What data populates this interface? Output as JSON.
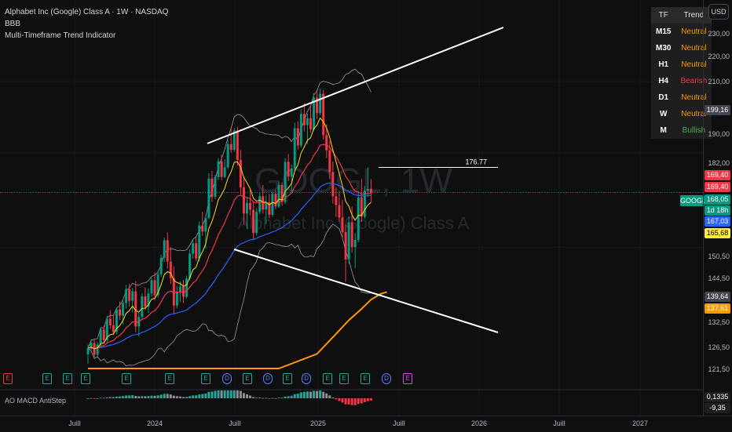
{
  "header": {
    "title": "Alphabet Inc (Google) Class A · 1W · NASDAQ",
    "indicator1": "BBB",
    "indicator2": "Multi-Timeframe Trend Indicator"
  },
  "watermark": {
    "ticker": "GOOGL, 1W",
    "name": "Alphabet Inc (Google) Class A"
  },
  "currency_button": "USD",
  "trend_table": {
    "headers": [
      "TF",
      "Trend"
    ],
    "rows": [
      {
        "tf": "M15",
        "trend": "Neutral",
        "color": "#ff9800"
      },
      {
        "tf": "M30",
        "trend": "Neutral",
        "color": "#ff9800"
      },
      {
        "tf": "H1",
        "trend": "Neutral",
        "color": "#ff9800"
      },
      {
        "tf": "H4",
        "trend": "Bearish",
        "color": "#f23645"
      },
      {
        "tf": "D1",
        "trend": "Neutral",
        "color": "#ff9800"
      },
      {
        "tf": "W",
        "trend": "Neutral",
        "color": "#ff9800"
      },
      {
        "tf": "M",
        "trend": "Bullish",
        "color": "#4caf50"
      }
    ]
  },
  "price_axis": {
    "labels": [
      "230,00",
      "220,00",
      "210,00",
      "190,00",
      "182,00",
      "150,50",
      "144,50",
      "132,50",
      "126,50",
      "121,50"
    ],
    "tags": [
      {
        "text": "199,16",
        "bg": "#434651"
      },
      {
        "text": "169,40",
        "bg": "#f23645"
      },
      {
        "text": "169,40",
        "bg": "#f23645"
      },
      {
        "text": "168,05",
        "bg": "#089981"
      },
      {
        "text": "1d 18h",
        "bg": "#089981"
      },
      {
        "text": "167,03",
        "bg": "#2962ff"
      },
      {
        "text": "165,68",
        "bg": "#ffeb3b",
        "fg": "#000000"
      },
      {
        "text": "139,64",
        "bg": "#434651"
      },
      {
        "text": "137,61",
        "bg": "#ff9800"
      },
      {
        "text": "0,1335",
        "bg": "#1e1e1e"
      },
      {
        "text": "-9,35",
        "bg": "#1e1e1e"
      }
    ]
  },
  "ticker_tag": "GOOGL",
  "level_label": "176.77",
  "time_axis": [
    "Juill",
    "2024",
    "Juill",
    "2025",
    "Juill",
    "2026",
    "Juill",
    "2027"
  ],
  "oscillator_label": "AO MACD AntiStep",
  "markers": {
    "e": "E",
    "d": "D"
  },
  "colors": {
    "up": "#089981",
    "down": "#f23645",
    "ema_fast": "#f9d71c",
    "ema_mid": "#f23645",
    "ema_slow": "#2962ff",
    "sma_long": "#ff9800",
    "bands": "#9598a1",
    "trendline": "#ffffff"
  },
  "chart_data": {
    "type": "candlestick",
    "title": "Alphabet Inc (Google) Class A · 1W · NASDAQ",
    "y_scale": "log",
    "ylim": [
      118,
      236
    ],
    "level": 176.77,
    "last_close": 168.05,
    "candles": [
      [
        121.4,
        123.8,
        119.2,
        122.9
      ],
      [
        122.9,
        125.1,
        121.8,
        124.2
      ],
      [
        124.2,
        125.0,
        120.6,
        121.3
      ],
      [
        121.3,
        124.4,
        120.9,
        123.8
      ],
      [
        123.8,
        128.2,
        123.1,
        127.6
      ],
      [
        127.6,
        128.6,
        124.0,
        124.9
      ],
      [
        124.9,
        131.2,
        124.3,
        130.4
      ],
      [
        130.4,
        132.7,
        127.8,
        128.7
      ],
      [
        128.7,
        131.6,
        126.2,
        127.0
      ],
      [
        127.0,
        133.4,
        126.4,
        132.9
      ],
      [
        132.9,
        135.0,
        130.1,
        131.2
      ],
      [
        131.2,
        135.3,
        129.0,
        134.6
      ],
      [
        134.6,
        139.6,
        133.1,
        138.4
      ],
      [
        138.4,
        139.9,
        133.7,
        135.2
      ],
      [
        135.2,
        138.7,
        132.1,
        137.8
      ],
      [
        137.8,
        140.6,
        126.9,
        128.4
      ],
      [
        128.4,
        132.1,
        125.9,
        130.9
      ],
      [
        130.9,
        137.3,
        130.1,
        136.4
      ],
      [
        136.4,
        138.9,
        132.7,
        133.6
      ],
      [
        133.6,
        138.6,
        131.9,
        137.2
      ],
      [
        137.2,
        141.7,
        136.4,
        140.9
      ],
      [
        140.9,
        143.1,
        135.4,
        136.7
      ],
      [
        136.7,
        143.5,
        136.1,
        142.6
      ],
      [
        142.6,
        148.3,
        141.8,
        147.4
      ],
      [
        147.4,
        153.5,
        146.1,
        152.7
      ],
      [
        152.7,
        155.1,
        144.2,
        146.3
      ],
      [
        146.3,
        150.7,
        139.8,
        141.5
      ],
      [
        141.5,
        144.9,
        131.6,
        133.9
      ],
      [
        133.9,
        139.3,
        133.2,
        137.7
      ],
      [
        137.7,
        140.6,
        134.9,
        139.1
      ],
      [
        139.1,
        141.0,
        134.6,
        136.3
      ],
      [
        136.3,
        142.2,
        135.8,
        141.4
      ],
      [
        141.4,
        149.9,
        140.8,
        148.6
      ],
      [
        148.6,
        153.1,
        147.1,
        151.8
      ],
      [
        151.8,
        153.7,
        146.4,
        147.2
      ],
      [
        147.2,
        158.5,
        146.3,
        157.3
      ],
      [
        157.3,
        161.7,
        154.0,
        155.4
      ],
      [
        155.4,
        160.6,
        150.1,
        159.7
      ],
      [
        159.7,
        174.7,
        159.2,
        172.8
      ],
      [
        172.8,
        175.5,
        164.9,
        166.6
      ],
      [
        166.6,
        174.1,
        165.8,
        173.3
      ],
      [
        173.3,
        180.1,
        172.4,
        178.9
      ],
      [
        178.9,
        181.3,
        172.2,
        173.4
      ],
      [
        173.4,
        179.6,
        173.0,
        176.8
      ],
      [
        176.8,
        186.7,
        176.2,
        185.2
      ],
      [
        185.2,
        191.8,
        182.0,
        183.1
      ],
      [
        183.1,
        191.3,
        182.4,
        190.3
      ],
      [
        190.3,
        191.7,
        177.3,
        179.4
      ],
      [
        179.4,
        183.1,
        167.3,
        169.8
      ],
      [
        169.8,
        173.5,
        157.6,
        161.1
      ],
      [
        161.1,
        166.4,
        156.1,
        164.6
      ],
      [
        164.6,
        168.9,
        160.4,
        162.3
      ],
      [
        162.3,
        165.2,
        152.8,
        154.9
      ],
      [
        154.9,
        162.9,
        154.2,
        161.7
      ],
      [
        161.7,
        168.1,
        160.9,
        166.8
      ],
      [
        166.8,
        170.6,
        161.1,
        162.4
      ],
      [
        162.4,
        167.1,
        157.7,
        164.8
      ],
      [
        164.8,
        167.5,
        159.6,
        160.7
      ],
      [
        160.7,
        168.4,
        160.0,
        167.6
      ],
      [
        167.6,
        168.8,
        162.5,
        163.4
      ],
      [
        163.4,
        171.8,
        162.9,
        170.6
      ],
      [
        170.6,
        171.6,
        163.7,
        164.9
      ],
      [
        164.9,
        180.1,
        164.2,
        178.7
      ],
      [
        178.7,
        181.6,
        171.9,
        173.5
      ],
      [
        173.5,
        177.8,
        168.3,
        176.4
      ],
      [
        176.4,
        193.3,
        175.9,
        191.2
      ],
      [
        191.2,
        193.9,
        183.2,
        184.7
      ],
      [
        184.7,
        198.7,
        183.9,
        196.8
      ],
      [
        196.8,
        201.1,
        190.0,
        192.4
      ],
      [
        192.4,
        196.9,
        185.3,
        195.1
      ],
      [
        195.1,
        200.2,
        189.6,
        190.8
      ],
      [
        190.8,
        205.2,
        190.1,
        203.4
      ],
      [
        203.4,
        206.7,
        194.8,
        197.1
      ],
      [
        197.1,
        207.1,
        196.3,
        204.9
      ],
      [
        204.9,
        206.5,
        186.9,
        188.6
      ],
      [
        188.6,
        192.7,
        180.1,
        182.9
      ],
      [
        182.9,
        186.4,
        172.6,
        175.1
      ],
      [
        175.1,
        178.9,
        164.4,
        166.8
      ],
      [
        166.8,
        169.8,
        160.0,
        163.9
      ],
      [
        163.9,
        168.6,
        158.3,
        159.8
      ],
      [
        159.8,
        165.6,
        153.0,
        155.2
      ],
      [
        155.2,
        157.6,
        140.4,
        146.9
      ],
      [
        146.9,
        160.2,
        145.6,
        158.3
      ],
      [
        158.3,
        163.4,
        148.9,
        150.6
      ],
      [
        150.6,
        154.9,
        144.4,
        152.8
      ],
      [
        152.8,
        168.6,
        152.1,
        166.4
      ],
      [
        166.4,
        172.8,
        158.4,
        160.1
      ],
      [
        160.1,
        170.3,
        159.4,
        168.7
      ],
      [
        168.7,
        176.8,
        166.5,
        169.3
      ],
      [
        169.3,
        172.7,
        164.9,
        168.05
      ]
    ],
    "sma_long_points": [
      [
        0,
        118
      ],
      [
        60,
        118
      ],
      [
        72,
        121.5
      ],
      [
        78,
        126.5
      ],
      [
        82,
        130.0
      ],
      [
        86,
        133.0
      ],
      [
        89,
        135.5
      ],
      [
        92,
        137.1
      ],
      [
        94,
        137.61
      ]
    ]
  }
}
